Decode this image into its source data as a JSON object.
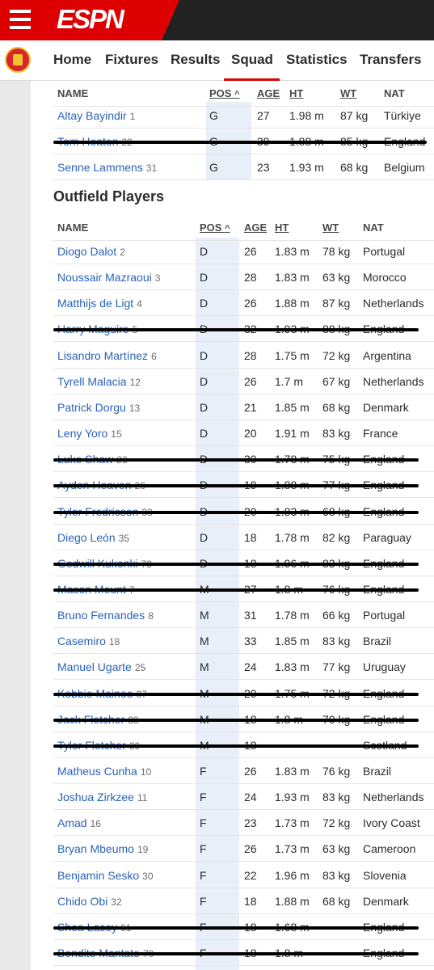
{
  "header": {
    "logo": "ESPN"
  },
  "nav": {
    "tabs": [
      "Home",
      "Fixtures",
      "Results",
      "Squad",
      "Statistics",
      "Transfers"
    ],
    "active": "Squad"
  },
  "gk_table": {
    "columns": [
      "NAME",
      "POS",
      "AGE",
      "HT",
      "WT",
      "NAT"
    ],
    "sort_indicator": "^",
    "rows": [
      {
        "name": "Altay Bayindir",
        "num": "1",
        "pos": "G",
        "age": "27",
        "ht": "1.98 m",
        "wt": "87 kg",
        "nat": "Türkiye",
        "struck": false
      },
      {
        "name": "Tom Heaton",
        "num": "22",
        "pos": "G",
        "age": "39",
        "ht": "1.88 m",
        "wt": "85 kg",
        "nat": "England",
        "struck": true
      },
      {
        "name": "Senne Lammens",
        "num": "31",
        "pos": "G",
        "age": "23",
        "ht": "1.93 m",
        "wt": "68 kg",
        "nat": "Belgium",
        "struck": false
      }
    ]
  },
  "outfield": {
    "title": "Outfield Players",
    "columns": [
      "NAME",
      "POS",
      "AGE",
      "HT",
      "WT",
      "NAT"
    ],
    "sort_indicator": "^",
    "rows": [
      {
        "name": "Diogo Dalot",
        "num": "2",
        "pos": "D",
        "age": "26",
        "ht": "1.83 m",
        "wt": "78 kg",
        "nat": "Portugal",
        "struck": false
      },
      {
        "name": "Noussair Mazraoui",
        "num": "3",
        "pos": "D",
        "age": "28",
        "ht": "1.83 m",
        "wt": "63 kg",
        "nat": "Morocco",
        "struck": false
      },
      {
        "name": "Matthijs de Ligt",
        "num": "4",
        "pos": "D",
        "age": "26",
        "ht": "1.88 m",
        "wt": "87 kg",
        "nat": "Netherlands",
        "struck": false
      },
      {
        "name": "Harry Maguire",
        "num": "5",
        "pos": "D",
        "age": "32",
        "ht": "1.93 m",
        "wt": "88 kg",
        "nat": "England",
        "struck": true
      },
      {
        "name": "Lisandro Martínez",
        "num": "6",
        "pos": "D",
        "age": "28",
        "ht": "1.75 m",
        "wt": "72 kg",
        "nat": "Argentina",
        "struck": false
      },
      {
        "name": "Tyrell Malacia",
        "num": "12",
        "pos": "D",
        "age": "26",
        "ht": "1.7 m",
        "wt": "67 kg",
        "nat": "Netherlands",
        "struck": false
      },
      {
        "name": "Patrick Dorgu",
        "num": "13",
        "pos": "D",
        "age": "21",
        "ht": "1.85 m",
        "wt": "68 kg",
        "nat": "Denmark",
        "struck": false
      },
      {
        "name": "Leny Yoro",
        "num": "15",
        "pos": "D",
        "age": "20",
        "ht": "1.91 m",
        "wt": "83 kg",
        "nat": "France",
        "struck": false
      },
      {
        "name": "Luke Shaw",
        "num": "23",
        "pos": "D",
        "age": "30",
        "ht": "1.78 m",
        "wt": "75 kg",
        "nat": "England",
        "struck": true
      },
      {
        "name": "Ayden Heaven",
        "num": "26",
        "pos": "D",
        "age": "19",
        "ht": "1.88 m",
        "wt": "77 kg",
        "nat": "England",
        "struck": true
      },
      {
        "name": "Tyler Fredricson",
        "num": "33",
        "pos": "D",
        "age": "20",
        "ht": "1.83 m",
        "wt": "68 kg",
        "nat": "England",
        "struck": true
      },
      {
        "name": "Diego León",
        "num": "35",
        "pos": "D",
        "age": "18",
        "ht": "1.78 m",
        "wt": "82 kg",
        "nat": "Paraguay",
        "struck": false
      },
      {
        "name": "Godwill Kukonki",
        "num": "73",
        "pos": "D",
        "age": "18",
        "ht": "1.96 m",
        "wt": "83 kg",
        "nat": "England",
        "struck": true
      },
      {
        "name": "Mason Mount",
        "num": "7",
        "pos": "M",
        "age": "27",
        "ht": "1.8 m",
        "wt": "76 kg",
        "nat": "England",
        "struck": true
      },
      {
        "name": "Bruno Fernandes",
        "num": "8",
        "pos": "M",
        "age": "31",
        "ht": "1.78 m",
        "wt": "66 kg",
        "nat": "Portugal",
        "struck": false
      },
      {
        "name": "Casemiro",
        "num": "18",
        "pos": "M",
        "age": "33",
        "ht": "1.85 m",
        "wt": "83 kg",
        "nat": "Brazil",
        "struck": false
      },
      {
        "name": "Manuel Ugarte",
        "num": "25",
        "pos": "M",
        "age": "24",
        "ht": "1.83 m",
        "wt": "77 kg",
        "nat": "Uruguay",
        "struck": false
      },
      {
        "name": "Kobbie Mainoo",
        "num": "37",
        "pos": "M",
        "age": "20",
        "ht": "1.75 m",
        "wt": "72 kg",
        "nat": "England",
        "struck": true
      },
      {
        "name": "Jack Fletcher",
        "num": "38",
        "pos": "M",
        "age": "18",
        "ht": "1.8 m",
        "wt": "70 kg",
        "nat": "England",
        "struck": true
      },
      {
        "name": "Tyler Fletcher",
        "num": "39",
        "pos": "M",
        "age": "18",
        "ht": "--",
        "wt": "--",
        "nat": "Scotland",
        "struck": true
      },
      {
        "name": "Matheus Cunha",
        "num": "10",
        "pos": "F",
        "age": "26",
        "ht": "1.83 m",
        "wt": "76 kg",
        "nat": "Brazil",
        "struck": false
      },
      {
        "name": "Joshua Zirkzee",
        "num": "11",
        "pos": "F",
        "age": "24",
        "ht": "1.93 m",
        "wt": "83 kg",
        "nat": "Netherlands",
        "struck": false
      },
      {
        "name": "Amad",
        "num": "16",
        "pos": "F",
        "age": "23",
        "ht": "1.73 m",
        "wt": "72 kg",
        "nat": "Ivory Coast",
        "struck": false
      },
      {
        "name": "Bryan Mbeumo",
        "num": "19",
        "pos": "F",
        "age": "26",
        "ht": "1.73 m",
        "wt": "63 kg",
        "nat": "Cameroon",
        "struck": false
      },
      {
        "name": "Benjamin Sesko",
        "num": "30",
        "pos": "F",
        "age": "22",
        "ht": "1.96 m",
        "wt": "83 kg",
        "nat": "Slovenia",
        "struck": false
      },
      {
        "name": "Chido Obi",
        "num": "32",
        "pos": "F",
        "age": "18",
        "ht": "1.88 m",
        "wt": "68 kg",
        "nat": "Denmark",
        "struck": false
      },
      {
        "name": "Shea Lacey",
        "num": "61",
        "pos": "F",
        "age": "18",
        "ht": "1.68 m",
        "wt": "--",
        "nat": "England",
        "struck": true
      },
      {
        "name": "Bendito Mantato",
        "num": "70",
        "pos": "F",
        "age": "18",
        "ht": "1.8 m",
        "wt": "--",
        "nat": "England",
        "struck": true
      }
    ]
  }
}
